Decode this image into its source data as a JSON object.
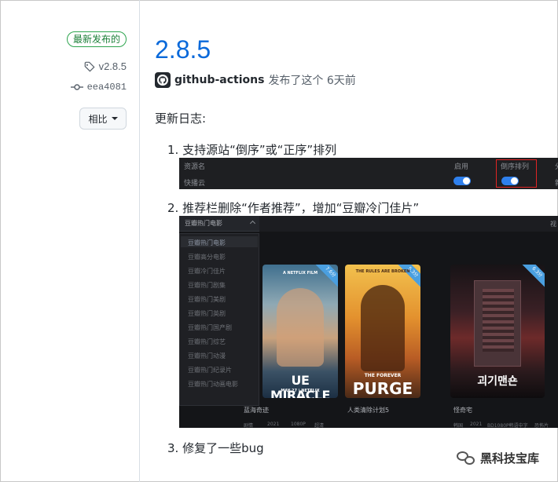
{
  "sidebar": {
    "latest_badge": "最新发布的",
    "tag": "v2.8.5",
    "commit": "eea4081",
    "compare_label": "相比"
  },
  "release": {
    "version": "2.8.5",
    "author": "github-actions",
    "published_text": "发布了这个 6天前"
  },
  "changelog": {
    "title": "更新日志:",
    "items": [
      "1. 支持源站“倒序”或“正序”排列",
      "2. 推荐栏删除“作者推荐”，增加“豆瓣冷门佳片”",
      "3. 修复了一些bug"
    ]
  },
  "screenshot1": {
    "headers": [
      "资源名",
      "启用",
      "倒序排列",
      "分"
    ],
    "row_name": "快播云",
    "row_extra": "新",
    "toggle_enabled": true,
    "toggle_reverse": true,
    "toggle_color": "#2f80ed",
    "highlight_color": "#e02424"
  },
  "screenshot2": {
    "dropdown_title": "豆瓣热门电影",
    "right_label": "视",
    "menu_items": [
      "豆瓣热门电影",
      "豆瓣高分电影",
      "豆瓣冷门佳片",
      "豆瓣热门剧集",
      "豆瓣热门美剧",
      "豆瓣热门英剧",
      "豆瓣热门国产剧",
      "豆瓣热门综艺",
      "豆瓣热门动漫",
      "豆瓣热门纪录片",
      "豆瓣热门动画电影"
    ],
    "posters": [
      {
        "title": "蓝海奇迹",
        "rating": "7.6分",
        "text_main": "UE MIRACLE",
        "text_sub": "MAY 27 | NETFLIX",
        "text_top": "A NETFLIX FILM",
        "meta": [
          "剧情",
          "2021",
          "1080P",
          "超清"
        ]
      },
      {
        "title": "人类清除计划5",
        "rating": "5.3分",
        "text_top": "THE RULES ARE BROKEN",
        "text_main": "PURGE",
        "text_sub": "THE FOREVER",
        "meta": []
      },
      {
        "title": "怪奇宅",
        "rating": "6.3分",
        "text_main": "괴기맨숀",
        "text_sub": "",
        "meta": [
          "韩国",
          "2021",
          "BD1080P韩语中字",
          "恐怖片"
        ]
      }
    ],
    "corner_color": "#4a9fe0"
  },
  "watermark": {
    "text": "黑科技宝库"
  }
}
